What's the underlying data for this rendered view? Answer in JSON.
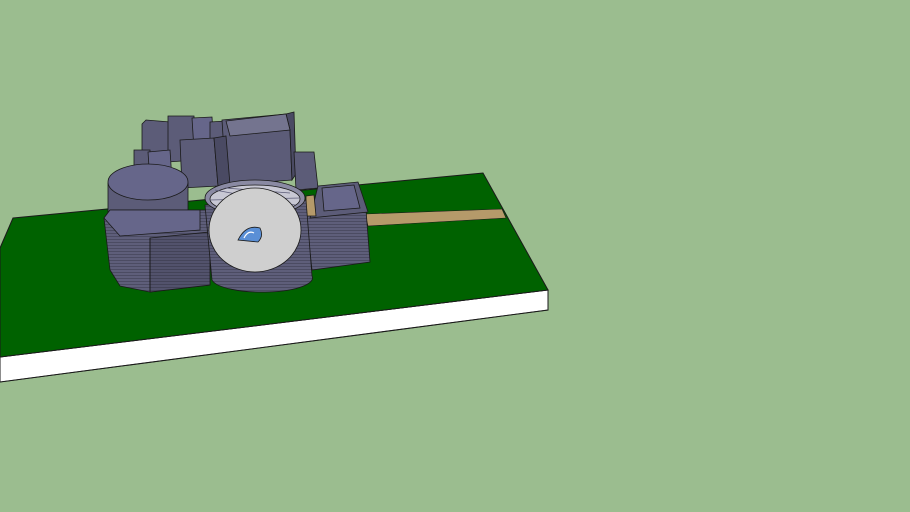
{
  "scene": {
    "kind": "3d-model-render",
    "colors": {
      "sky": "#9bbd8f",
      "grass": "#006200",
      "base_front": "#ffffff",
      "base_side": "#e6e6e6",
      "building": "#5c5c78",
      "building_dark": "#4a4a63",
      "building_light": "#74748f",
      "tower_top": "#cfcfcf",
      "path": "#b59a6a",
      "outline": "#1a1a1a",
      "window": "#5a8fd6"
    }
  }
}
